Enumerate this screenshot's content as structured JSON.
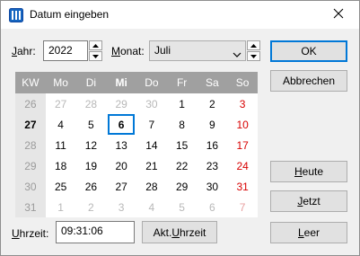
{
  "window": {
    "title": "Datum eingeben"
  },
  "year": {
    "label_u": "J",
    "label_rest": "ahr:",
    "value": "2022"
  },
  "month": {
    "label_u": "M",
    "label_rest": "onat:",
    "value": "Juli"
  },
  "calendar": {
    "headers": [
      "KW",
      "Mo",
      "Di",
      "Mi",
      "Do",
      "Fr",
      "Sa",
      "So"
    ],
    "weeks": [
      {
        "kw": "26",
        "days": [
          "27",
          "28",
          "29",
          "30",
          "1",
          "2",
          "3"
        ]
      },
      {
        "kw": "27",
        "days": [
          "4",
          "5",
          "6",
          "7",
          "8",
          "9",
          "10"
        ]
      },
      {
        "kw": "28",
        "days": [
          "11",
          "12",
          "13",
          "14",
          "15",
          "16",
          "17"
        ]
      },
      {
        "kw": "29",
        "days": [
          "18",
          "19",
          "20",
          "21",
          "22",
          "23",
          "24"
        ]
      },
      {
        "kw": "30",
        "days": [
          "25",
          "26",
          "27",
          "28",
          "29",
          "30",
          "31"
        ]
      },
      {
        "kw": "31",
        "days": [
          "1",
          "2",
          "3",
          "4",
          "5",
          "6",
          "7"
        ]
      }
    ],
    "selected_day": "6"
  },
  "time": {
    "label_u": "U",
    "label_rest": "hrzeit:",
    "value": "09:31:06"
  },
  "buttons": {
    "ok": "OK",
    "cancel": "Abbrechen",
    "today_u": "H",
    "today_rest": "eute",
    "now_u": "J",
    "now_rest": "etzt",
    "empty_u": "L",
    "empty_rest": "eer",
    "current_time_prefix": "Akt. ",
    "current_time_u": "U",
    "current_time_rest": "hrzeit"
  },
  "icons": {
    "app": "calendar-app-icon",
    "close": "close-icon"
  },
  "colors": {
    "accent": "#0078d7",
    "sunday": "#d80000",
    "header_bg": "#a0a0a0"
  }
}
